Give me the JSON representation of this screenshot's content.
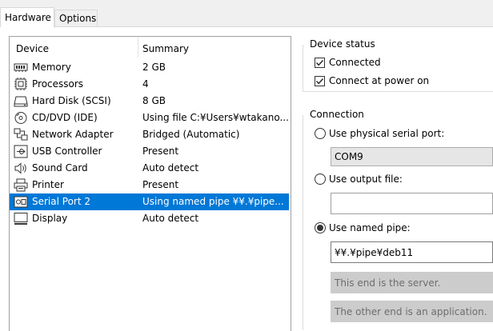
{
  "tabs": {
    "hardware": "Hardware",
    "options": "Options"
  },
  "device_list": {
    "headers": {
      "device": "Device",
      "summary": "Summary"
    },
    "rows": [
      {
        "device": "Memory",
        "summary": "2 GB",
        "icon": "memory-icon"
      },
      {
        "device": "Processors",
        "summary": "4",
        "icon": "processor-icon"
      },
      {
        "device": "Hard Disk (SCSI)",
        "summary": "8 GB",
        "icon": "hard-disk-icon"
      },
      {
        "device": "CD/DVD (IDE)",
        "summary": "Using file C:¥Users¥wtakano...",
        "icon": "cd-dvd-icon"
      },
      {
        "device": "Network Adapter",
        "summary": "Bridged (Automatic)",
        "icon": "network-adapter-icon"
      },
      {
        "device": "USB Controller",
        "summary": "Present",
        "icon": "usb-icon"
      },
      {
        "device": "Sound Card",
        "summary": "Auto detect",
        "icon": "speaker-icon"
      },
      {
        "device": "Printer",
        "summary": "Present",
        "icon": "printer-icon"
      },
      {
        "device": "Serial Port 2",
        "summary": "Using named pipe ¥¥.¥pipe...",
        "icon": "serial-port-icon",
        "selected": true
      },
      {
        "device": "Display",
        "summary": "Auto detect",
        "icon": "display-icon"
      }
    ]
  },
  "device_status": {
    "title": "Device status",
    "connected": {
      "label": "Connected",
      "checked": true
    },
    "connect_at_power_on": {
      "label": "Connect at power on",
      "checked": true
    }
  },
  "connection": {
    "title": "Connection",
    "physical": {
      "label": "Use physical serial port:",
      "selected": false,
      "value": "COM9"
    },
    "output_file": {
      "label": "Use output file:",
      "selected": false,
      "value": ""
    },
    "named_pipe": {
      "label": "Use named pipe:",
      "selected": true,
      "value": "¥¥.¥pipe¥deb11",
      "end": "This end is the server.",
      "other_end": "The other end is an application."
    }
  },
  "colors": {
    "selection": "#0078d7"
  }
}
